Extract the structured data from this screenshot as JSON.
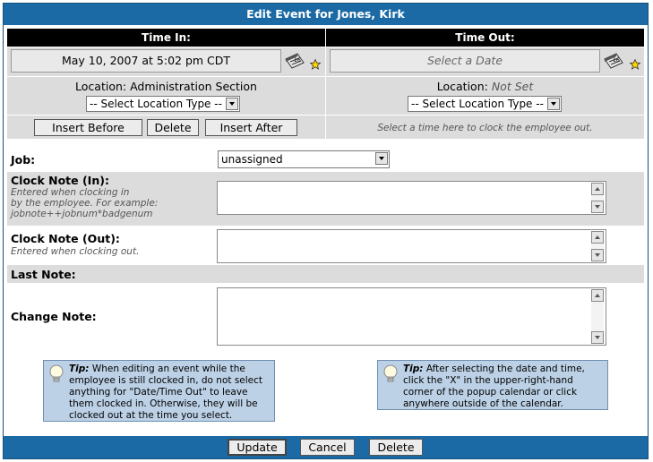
{
  "title": "Edit Event for Jones, Kirk",
  "time_in": {
    "header": "Time In:",
    "date": "May 10, 2007 at 5:02 pm CDT",
    "location_prefix": "Location:",
    "location_value": "Administration Section",
    "location_select": "-- Select Location Type --",
    "buttons": {
      "insert_before": "Insert Before",
      "delete": "Delete",
      "insert_after": "Insert After"
    }
  },
  "time_out": {
    "header": "Time Out:",
    "date_placeholder": "Select a Date",
    "location_prefix": "Location:",
    "location_value": "Not Set",
    "location_select": "-- Select Location Type --",
    "hint": "Select a time here to clock the employee out."
  },
  "job": {
    "label": "Job:",
    "value": "unassigned"
  },
  "clock_note_in": {
    "label": "Clock Note (In):",
    "hint_1": "Entered when clocking in",
    "hint_2": "by the employee. For example:",
    "hint_3": "jobnote++jobnum*badgenum"
  },
  "clock_note_out": {
    "label": "Clock Note (Out):",
    "hint": "Entered when clocking out."
  },
  "last_note": {
    "label": "Last Note:"
  },
  "change_note": {
    "label": "Change Note:"
  },
  "tips": [
    {
      "heading": "Tip:",
      "text": "When editing an event while the employee is still clocked in, do not select anything for \"Date/Time Out\" to leave them clocked in. Otherwise, they will be clocked out at the time you select."
    },
    {
      "heading": "Tip:",
      "text": "After selecting the date and time, click the \"X\" in the upper-right-hand corner of the popup calendar or click anywhere outside of the calendar."
    }
  ],
  "footer": {
    "update": "Update",
    "cancel": "Cancel",
    "delete": "Delete"
  },
  "colors": {
    "title_bar": "#1b6aa5",
    "tip_bg": "#bcd1e6",
    "section_gray": "#dcdcdc"
  }
}
